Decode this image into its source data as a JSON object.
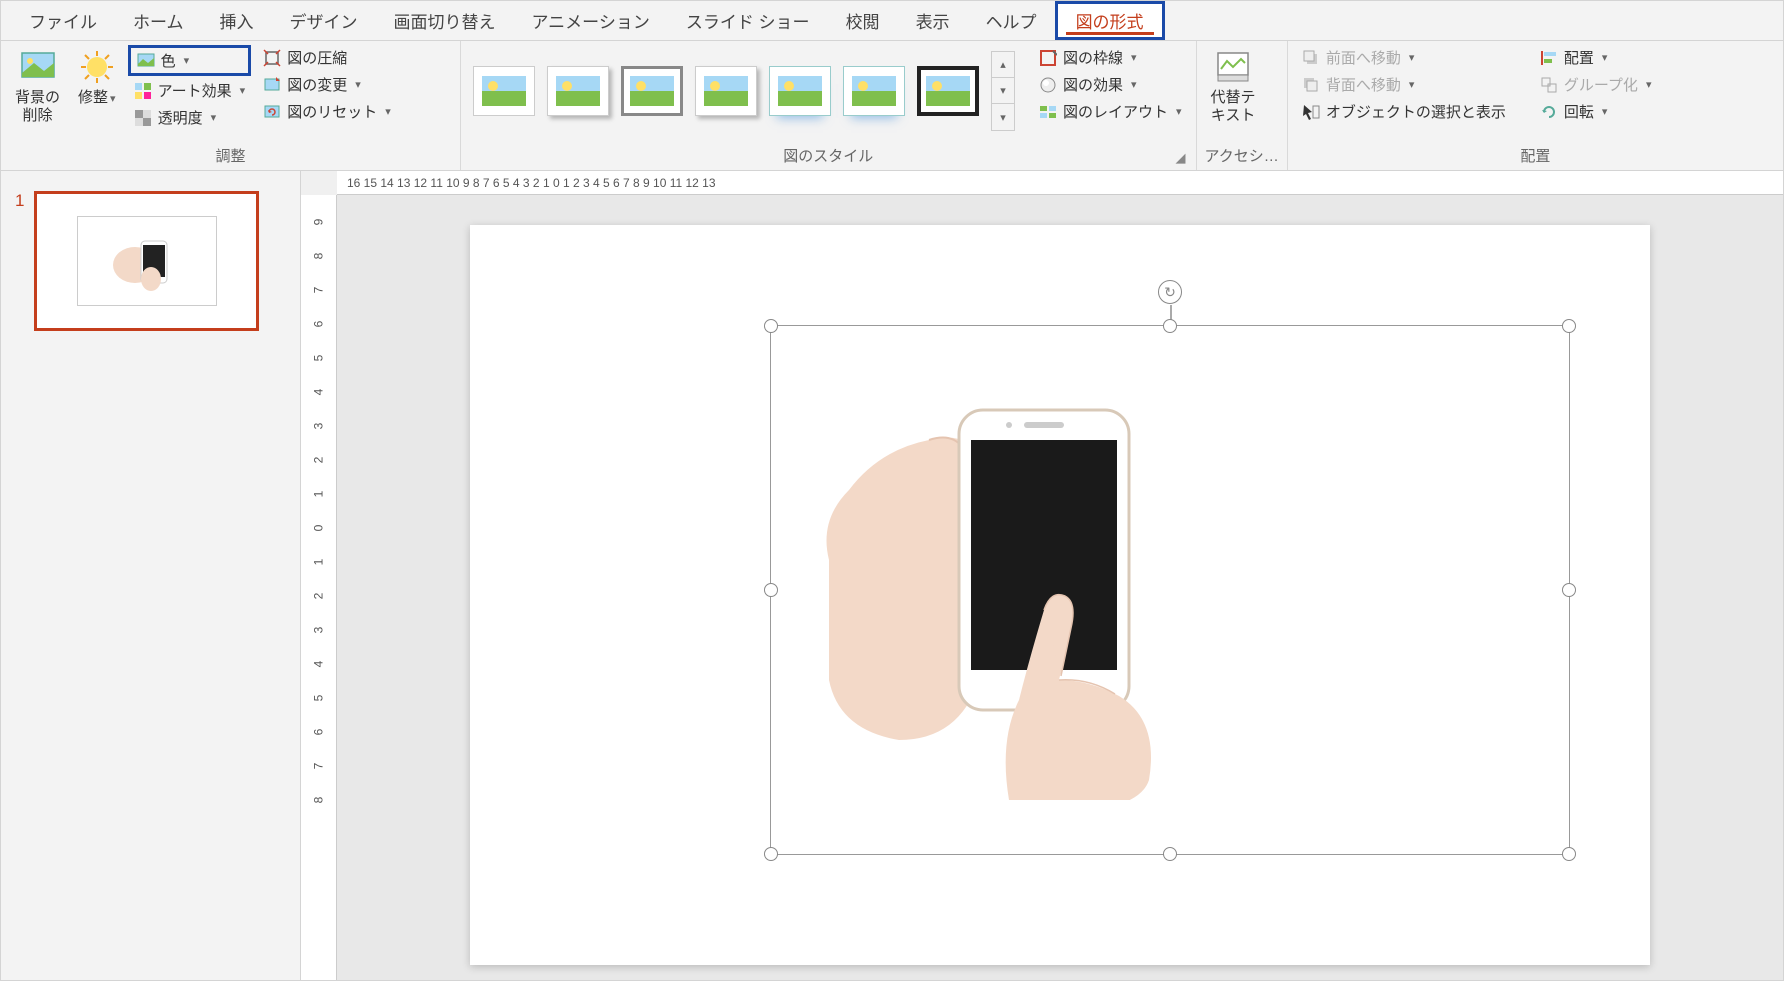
{
  "tabs": {
    "file": "ファイル",
    "home": "ホーム",
    "insert": "挿入",
    "design": "デザイン",
    "transitions": "画面切り替え",
    "animations": "アニメーション",
    "slideshow": "スライド ショー",
    "review": "校閲",
    "view": "表示",
    "help": "ヘルプ",
    "picture_format": "図の形式"
  },
  "ribbon": {
    "remove_bg": "背景の\n削除",
    "corrections": "修整",
    "color": "色",
    "artistic": "アート効果",
    "transparency": "透明度",
    "compress": "図の圧縮",
    "change": "図の変更",
    "reset": "図のリセット",
    "group_adjust": "調整",
    "group_styles": "図のスタイル",
    "border": "図の枠線",
    "effects": "図の効果",
    "layout": "図のレイアウト",
    "alt_text": "代替テ\nキスト",
    "group_access": "アクセシ…",
    "bring_forward": "前面へ移動",
    "send_backward": "背面へ移動",
    "selection_pane": "オブジェクトの選択と表示",
    "align": "配置",
    "group": "グループ化",
    "rotate": "回転",
    "group_arrange": "配置"
  },
  "slide_panel": {
    "num": "1"
  },
  "ruler_h": "16  15  14  13  12  11  10  9  8  7  6  5  4  3  2  1  0  1  2  3  4  5  6  7  8  9  10  11  12  13",
  "ruler_v": [
    "9",
    "8",
    "7",
    "6",
    "5",
    "4",
    "3",
    "2",
    "1",
    "0",
    "1",
    "2",
    "3",
    "4",
    "5",
    "6",
    "7",
    "8"
  ]
}
